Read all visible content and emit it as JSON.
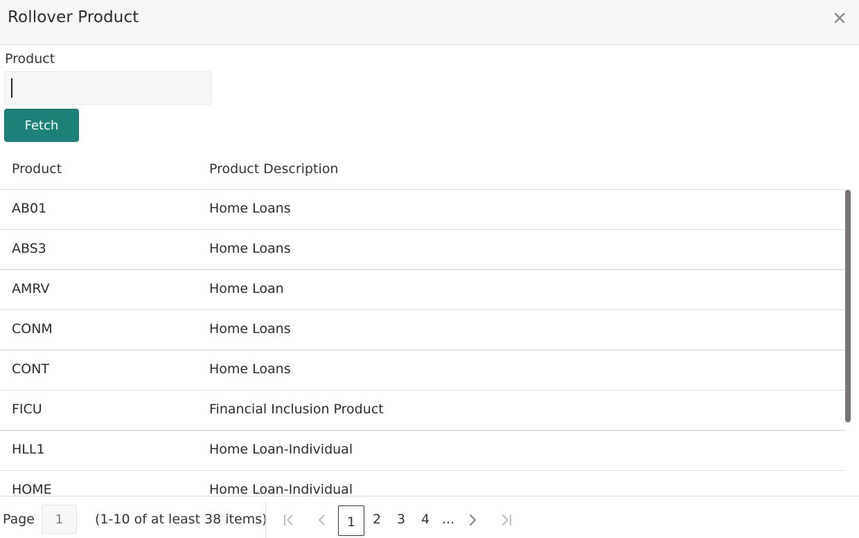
{
  "dialog": {
    "title": "Rollover Product",
    "close_icon": "close-icon"
  },
  "filter": {
    "label": "Product",
    "value": "",
    "fetch_label": "Fetch"
  },
  "table": {
    "columns": [
      "Product",
      "Product Description"
    ],
    "rows": [
      {
        "product": "AB01",
        "description": "Home Loans"
      },
      {
        "product": "ABS3",
        "description": "Home Loans"
      },
      {
        "product": "AMRV",
        "description": "Home Loan"
      },
      {
        "product": "CONM",
        "description": "Home Loans"
      },
      {
        "product": "CONT",
        "description": "Home Loans"
      },
      {
        "product": "FICU",
        "description": "Financial Inclusion Product"
      },
      {
        "product": "HLL1",
        "description": "Home Loan-Individual"
      },
      {
        "product": "HOME",
        "description": "Home Loan-Individual"
      }
    ]
  },
  "pagination": {
    "page_label": "Page",
    "page_value": "1",
    "items_info": "(1-10 of at least 38 items)",
    "current_page": "1",
    "pages": [
      "2",
      "3",
      "4"
    ],
    "ellipsis": "...",
    "icons": {
      "first": "first-page-icon",
      "prev": "previous-page-icon",
      "next": "next-page-icon",
      "last": "last-page-icon"
    }
  },
  "colors": {
    "accent": "#1e8179",
    "header_bg": "#f7f7f7",
    "scrollbar": "#7a7474"
  }
}
